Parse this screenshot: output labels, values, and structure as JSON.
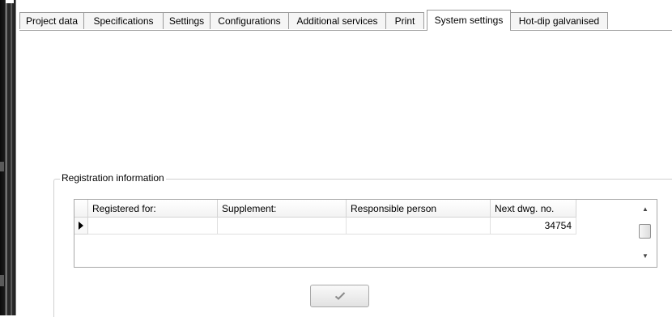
{
  "tabs": [
    {
      "label": "Project data",
      "active": false
    },
    {
      "label": "Specifications",
      "active": false
    },
    {
      "label": "Settings",
      "active": false
    },
    {
      "label": "Configurations",
      "active": false
    },
    {
      "label": "Additional services",
      "active": false
    },
    {
      "label": "Print",
      "active": false
    },
    {
      "label": "System settings",
      "active": true
    },
    {
      "label": "Hot-dip galvanised",
      "active": false
    }
  ],
  "registration": {
    "group_title": "Registration information",
    "columns": [
      "Registered for:",
      "Supplement:",
      "Responsible person",
      "Next dwg. no."
    ],
    "rows": [
      {
        "registered_for": "",
        "supplement": "",
        "responsible_person": "",
        "next_dwg_no": "34754"
      }
    ]
  },
  "icons": {
    "current_row": "row-pointer-icon",
    "confirm": "checkmark-icon",
    "scroll_up": "arrow-up-icon",
    "scroll_down": "arrow-down-icon"
  }
}
